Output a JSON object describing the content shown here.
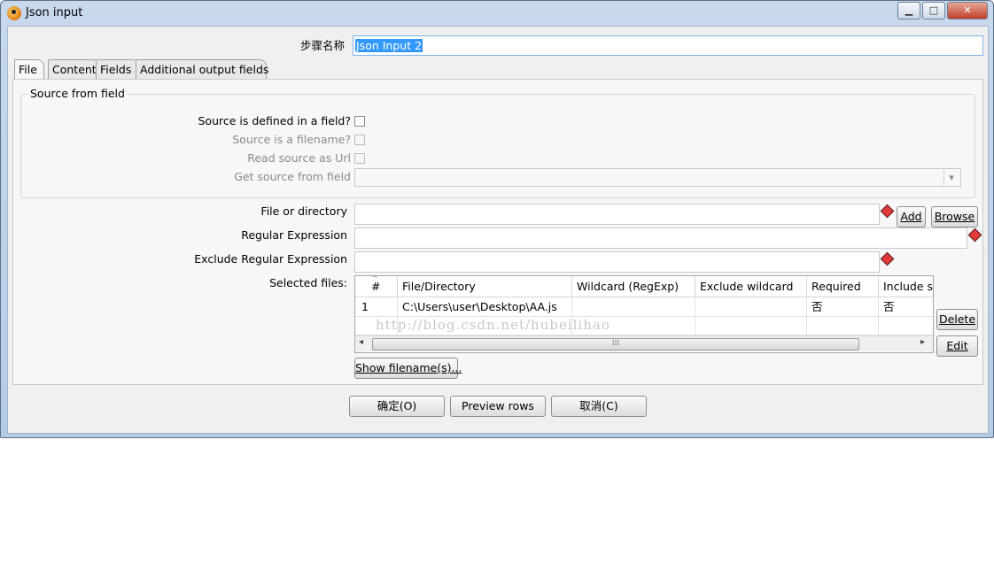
{
  "window": {
    "title": "Json input",
    "controls": {
      "minimize": "▁",
      "maximize": "□",
      "close": "✕"
    }
  },
  "step": {
    "label": "步骤名称",
    "value": "Json Input 2"
  },
  "tabs": [
    "File",
    "Content",
    "Fields",
    "Additional output fields"
  ],
  "source_from_field": {
    "title": "Source from field",
    "defined_in_field_label": "Source is defined in a field?",
    "is_filename_label": "Source is a filename?",
    "read_as_url_label": "Read source as Url",
    "get_from_field_label": "Get source from field",
    "get_from_field_value": "",
    "dropdown_arrow": "▾"
  },
  "file_or_directory": {
    "label": "File or directory",
    "value": "",
    "add": "Add",
    "browse": "Browse"
  },
  "regex": {
    "label": "Regular Expression",
    "value": ""
  },
  "exclude_regex": {
    "label": "Exclude Regular Expression",
    "value": ""
  },
  "selected_files": {
    "label": "Selected files:",
    "sort_glyph": "⌃",
    "columns": [
      "#",
      "File/Directory",
      "Wildcard (RegExp)",
      "Exclude wildcard",
      "Required",
      "Include s"
    ],
    "rows": [
      {
        "num": "1",
        "file": "C:\\Users\\user\\Desktop\\AA.js",
        "wildcard": "",
        "exclude": "",
        "required": "否",
        "include": "否"
      }
    ],
    "scroll_left": "◂",
    "scroll_right": "▸",
    "grip": "⁞⁞⁞"
  },
  "watermark": "http://blog.csdn.net/hubeilihao",
  "buttons": {
    "delete": "Delete",
    "edit": "Edit",
    "show_filenames": "Show filename(s)...",
    "ok": "确定(O)",
    "preview": "Preview rows",
    "cancel": "取消(C)"
  },
  "colors": {
    "selection": "#3399ff",
    "warning": "#e23a3a",
    "frame": "#b4cbe6"
  }
}
